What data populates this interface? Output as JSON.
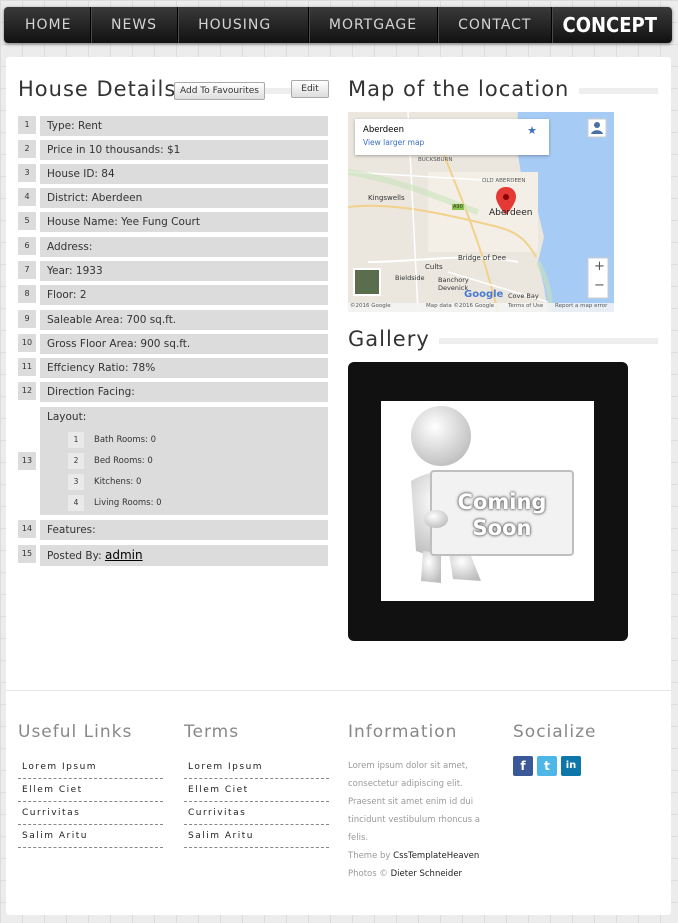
{
  "nav": {
    "items": [
      "HOME",
      "NEWS",
      "HOUSING RENTAL",
      "MORTGAGE",
      "CONTACT"
    ],
    "brand": "CONCEPT"
  },
  "details": {
    "title": "House Details",
    "favourites_label": "Add To Favourites",
    "edit_label": "Edit",
    "rows": [
      {
        "n": "1",
        "text": "Type: Rent"
      },
      {
        "n": "2",
        "text": "Price in 10 thousands: $1"
      },
      {
        "n": "3",
        "text": "House ID: 84"
      },
      {
        "n": "4",
        "text": "District: Aberdeen"
      },
      {
        "n": "5",
        "text": "House Name: Yee Fung Court"
      },
      {
        "n": "6",
        "text": "Address:"
      },
      {
        "n": "7",
        "text": "Year: 1933"
      },
      {
        "n": "8",
        "text": "Floor: 2"
      },
      {
        "n": "9",
        "text": "Saleable Area: 700 sq.ft."
      },
      {
        "n": "10",
        "text": "Gross Floor Area: 900 sq.ft."
      },
      {
        "n": "11",
        "text": "Effciency Ratio: 78%"
      },
      {
        "n": "12",
        "text": "Direction Facing:"
      }
    ],
    "layout": {
      "n": "13",
      "label": "Layout:",
      "items": [
        {
          "n": "1",
          "text": "Bath Rooms: 0"
        },
        {
          "n": "2",
          "text": "Bed Rooms: 0"
        },
        {
          "n": "3",
          "text": "Kitchens: 0"
        },
        {
          "n": "4",
          "text": "Living Rooms: 0"
        }
      ]
    },
    "features": {
      "n": "14",
      "text": "Features:"
    },
    "posted": {
      "n": "15",
      "prefix": "Posted By: ",
      "user": "admin"
    }
  },
  "map": {
    "title": "Map of the location",
    "place": "Aberdeen",
    "larger_map": "View larger map",
    "labels": {
      "bucksburn": "BUCKSBURN",
      "old_aberdeen": "OLD ABERDEEN",
      "kingswells": "Kingswells",
      "aberdeen": "Aberdeen",
      "a90": "A90",
      "bridge_of_dee": "Bridge of Dee",
      "cults": "Cults",
      "bieldside": "Bieldside",
      "banchory": "Banchory",
      "devenick": "Devenick",
      "cove_bay": "Cove Bay",
      "google": "Google"
    },
    "footer": {
      "copyright": "©2016 Google",
      "map_data": "Map data ©2016 Google",
      "terms": "Terms of Use",
      "report": "Report a map error"
    },
    "zoom_in": "+",
    "zoom_out": "−"
  },
  "gallery": {
    "title": "Gallery",
    "placeholder_line1": "Coming",
    "placeholder_line2": "Soon"
  },
  "footer": {
    "useful_links": {
      "title": "Useful Links",
      "items": [
        "Lorem Ipsum",
        "Ellem Ciet",
        "Currivitas",
        "Salim Aritu"
      ]
    },
    "terms": {
      "title": "Terms",
      "items": [
        "Lorem Ipsum",
        "Ellem Ciet",
        "Currivitas",
        "Salim Aritu"
      ]
    },
    "information": {
      "title": "Information",
      "text": "Lorem ipsum dolor sit amet, consectetur adipiscing elit. Praesent sit amet enim id dui tincidunt vestibulum rhoncus a felis.",
      "theme_prefix": "Theme by ",
      "theme_author": "CssTemplateHeaven",
      "photos_prefix": "Photos © ",
      "photos_author": "Dieter Schneider"
    },
    "socialize": {
      "title": "Socialize",
      "facebook": "f",
      "twitter": "t",
      "linkedin": "in"
    }
  }
}
